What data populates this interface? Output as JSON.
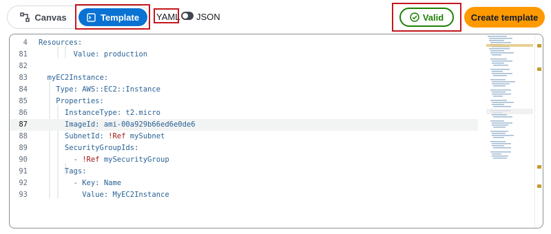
{
  "toolbar": {
    "canvas_label": "Canvas",
    "template_label": "Template",
    "yaml_label": "YAML",
    "json_label": "JSON",
    "valid_label": "Valid",
    "create_label": "Create template"
  },
  "colors": {
    "template_active": "#0972d3",
    "valid_green": "#1d8102",
    "create_orange": "#ff9900",
    "highlight_red": "#c4161c",
    "yaml_key": "#2a6296",
    "yaml_tag": "#a31515"
  },
  "editor": {
    "active_line": "87",
    "lines": [
      {
        "num": "4",
        "pre": "Resources:",
        "tag": "",
        "post": ""
      },
      {
        "num": "81",
        "pre": "        Value: production",
        "tag": "",
        "post": ""
      },
      {
        "num": "82",
        "pre": "",
        "tag": "",
        "post": ""
      },
      {
        "num": "83",
        "pre": "  myEC2Instance:",
        "tag": "",
        "post": ""
      },
      {
        "num": "84",
        "pre": "    Type: AWS::EC2::Instance",
        "tag": "",
        "post": ""
      },
      {
        "num": "85",
        "pre": "    Properties:",
        "tag": "",
        "post": ""
      },
      {
        "num": "86",
        "pre": "      InstanceType: t2.micro",
        "tag": "",
        "post": ""
      },
      {
        "num": "87",
        "pre": "      ImageId: ami-00a929b66ed6e0de6",
        "tag": "",
        "post": ""
      },
      {
        "num": "88",
        "pre": "      SubnetId: ",
        "tag": "!Ref",
        "post": " mySubnet"
      },
      {
        "num": "89",
        "pre": "      SecurityGroupIds:",
        "tag": "",
        "post": ""
      },
      {
        "num": "90",
        "pre": "        - ",
        "tag": "!Ref",
        "post": " mySecurityGroup"
      },
      {
        "num": "91",
        "pre": "      Tags:",
        "tag": "",
        "post": ""
      },
      {
        "num": "92",
        "pre": "        - Key: Name",
        "tag": "",
        "post": ""
      },
      {
        "num": "93",
        "pre": "          Value: MyEC2Instance",
        "tag": "",
        "post": ""
      }
    ]
  }
}
